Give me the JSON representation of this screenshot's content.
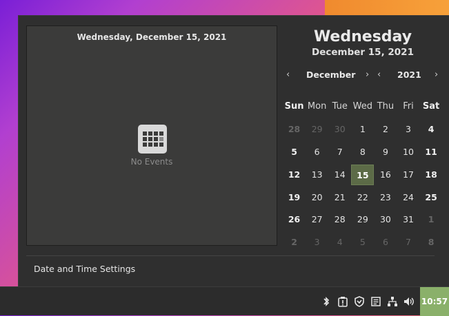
{
  "events_panel": {
    "date_heading": "Wednesday, December 15, 2021",
    "empty_label": "No Events"
  },
  "settings_link": "Date and Time Settings",
  "calendar": {
    "weekday_big": "Wednesday",
    "date_big": "December 15, 2021",
    "month": "December",
    "year": "2021",
    "prev_arrow": "‹",
    "next_arrow": "›",
    "weekdays": [
      "Sun",
      "Mon",
      "Tue",
      "Wed",
      "Thu",
      "Fri",
      "Sat"
    ],
    "weeks": [
      [
        "28",
        "29",
        "30",
        "1",
        "2",
        "3",
        "4"
      ],
      [
        "5",
        "6",
        "7",
        "8",
        "9",
        "10",
        "11"
      ],
      [
        "12",
        "13",
        "14",
        "15",
        "16",
        "17",
        "18"
      ],
      [
        "19",
        "20",
        "21",
        "22",
        "23",
        "24",
        "25"
      ],
      [
        "26",
        "27",
        "28",
        "29",
        "30",
        "31",
        "1"
      ],
      [
        "2",
        "3",
        "4",
        "5",
        "6",
        "7",
        "8"
      ]
    ],
    "today": "15",
    "accent_today": "#5c6b47"
  },
  "panel": {
    "clock": "10:57",
    "clock_bg": "#8ab06a",
    "tray_icons": [
      "bluetooth-icon",
      "update-manager-icon",
      "shield-icon",
      "notes-icon",
      "network-icon",
      "volume-icon"
    ]
  }
}
